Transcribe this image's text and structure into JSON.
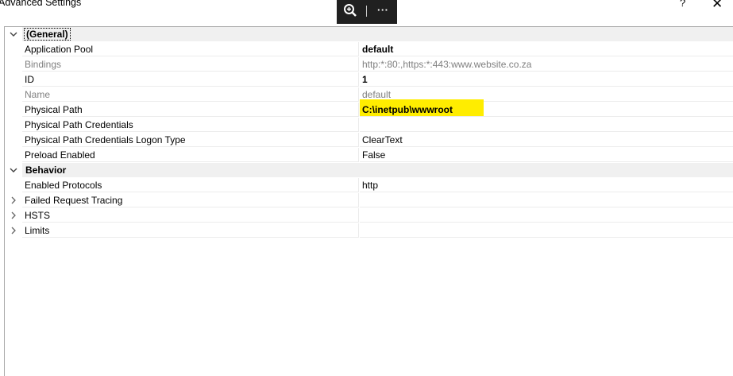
{
  "window": {
    "title": "Advanced Settings",
    "help_label": "?",
    "close_label": "✕"
  },
  "overlay_toolbar": {
    "zoom_icon": "zoom-in-icon",
    "more_label": "···"
  },
  "general_category": {
    "label": "(General)"
  },
  "behavior_category": {
    "label": "Behavior"
  },
  "properties": {
    "app_pool": {
      "name": "Application Pool",
      "value": "default"
    },
    "bindings": {
      "name": "Bindings",
      "value": "http:*:80:,https:*:443:www.website.co.za"
    },
    "id": {
      "name": "ID",
      "value": "1"
    },
    "site_name": {
      "name": "Name",
      "value": "default"
    },
    "physical_path": {
      "name": "Physical Path",
      "value": "C:\\inetpub\\wwwroot"
    },
    "path_credentials": {
      "name": "Physical Path Credentials",
      "value": ""
    },
    "logon_type": {
      "name": "Physical Path Credentials Logon Type",
      "value": "ClearText"
    },
    "preload": {
      "name": "Preload Enabled",
      "value": "False"
    },
    "enabled_protocols": {
      "name": "Enabled Protocols",
      "value": "http"
    },
    "failed_request_tracing": {
      "name": "Failed Request Tracing",
      "value": ""
    },
    "hsts": {
      "name": "HSTS",
      "value": ""
    },
    "limits": {
      "name": "Limits",
      "value": ""
    }
  },
  "colors": {
    "highlight": "#ffed00",
    "category_background": "#f0f0f0",
    "readonly_text": "#808080",
    "toolbar_background": "#202020"
  }
}
